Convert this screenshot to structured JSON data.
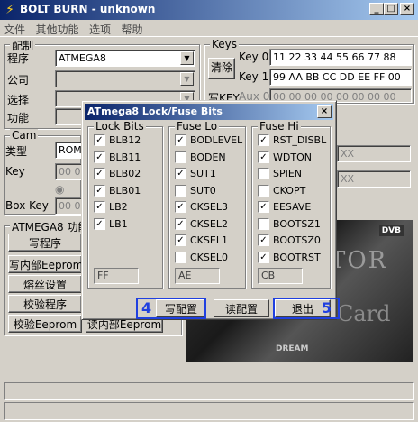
{
  "window": {
    "title": "BOLT BURN - unknown"
  },
  "menu": [
    "文件",
    "其他功能",
    "选项",
    "帮助"
  ],
  "config": {
    "title": "配制",
    "program_label": "程序",
    "program_value": "ATMEGA8",
    "company_label": "公司",
    "select_label": "选择",
    "function_label": "功能"
  },
  "keys": {
    "title": "Keys",
    "clear_label": "清除",
    "key0_label": "Key 0",
    "key0_value": "11 22 33 44 55 66 77 88",
    "key1_label": "Key 1",
    "key1_value": "99 AA BB CC DD EE FF 00",
    "writekey_label": "写KEY",
    "aux0_label": "Aux 0",
    "aux0_value": "00 00 00 00 00 00 00 00"
  },
  "cam": {
    "title": "Cam",
    "type_label": "类型",
    "type_value": "ROM",
    "key_label": "Key",
    "key_value": "00 00",
    "radio_label": "Ke",
    "boxkey_label": "Box Key",
    "boxkey_value": "00 00",
    "right_value_1": "XX",
    "right_value_2": "XX"
  },
  "functions": {
    "title": "ATMEGA8 功能",
    "write_program": "写程序",
    "write_eeprom": "写内部Eeprom",
    "fuse_settings": "熔丝设置",
    "verify_program": "校验程序",
    "verify_eeprom": "校验Eeprom",
    "hidden_button": "读内部Eeprom"
  },
  "preview": {
    "brand": "DREAM",
    "badge": "DVB",
    "text1": "TOR",
    "text2": "Card"
  },
  "dialog": {
    "title": "ATmega8  Lock/Fuse Bits",
    "lock_bits": {
      "title": "Lock Bits",
      "items": [
        {
          "name": "BLB12",
          "checked": true
        },
        {
          "name": "BLB11",
          "checked": true
        },
        {
          "name": "BLB02",
          "checked": true
        },
        {
          "name": "BLB01",
          "checked": true
        },
        {
          "name": "LB2",
          "checked": true
        },
        {
          "name": "LB1",
          "checked": true
        }
      ],
      "value": "FF"
    },
    "fuse_lo": {
      "title": "Fuse Lo",
      "items": [
        {
          "name": "BODLEVEL",
          "checked": true
        },
        {
          "name": "BODEN",
          "checked": false
        },
        {
          "name": "SUT1",
          "checked": true
        },
        {
          "name": "SUT0",
          "checked": false
        },
        {
          "name": "CKSEL3",
          "checked": true
        },
        {
          "name": "CKSEL2",
          "checked": true
        },
        {
          "name": "CKSEL1",
          "checked": true
        },
        {
          "name": "CKSEL0",
          "checked": false
        }
      ],
      "value": "AE"
    },
    "fuse_hi": {
      "title": "Fuse Hi",
      "items": [
        {
          "name": "RST_DISBL",
          "checked": true
        },
        {
          "name": "WDTON",
          "checked": true
        },
        {
          "name": "SPIEN",
          "checked": false
        },
        {
          "name": "CKOPT",
          "checked": false
        },
        {
          "name": "EESAVE",
          "checked": true
        },
        {
          "name": "BOOTSZ1",
          "checked": false
        },
        {
          "name": "BOOTSZ0",
          "checked": true
        },
        {
          "name": "BOOTRST",
          "checked": true
        }
      ],
      "value": "CB"
    },
    "write_config": "写配置",
    "read_config": "读配置",
    "exit": "退出",
    "callout_write": "4",
    "callout_exit": "5"
  }
}
